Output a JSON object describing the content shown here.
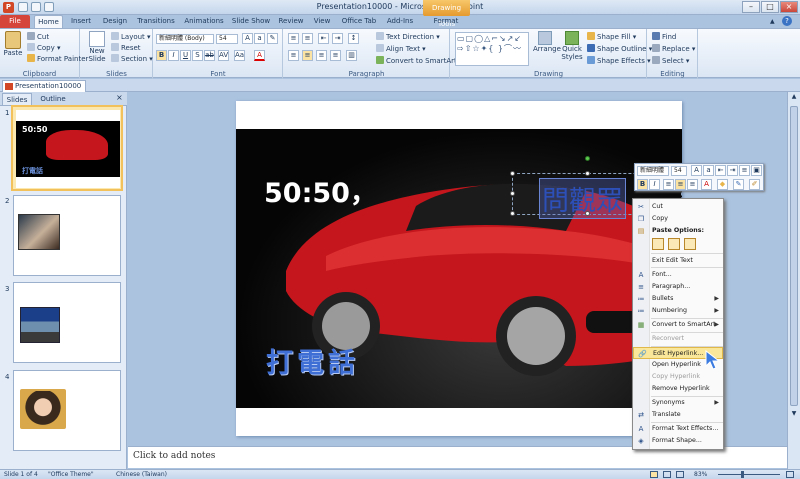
{
  "window": {
    "title": "Presentation10000  -  Microsoft PowerPoint",
    "contextual_tab_group": "Drawing Tools"
  },
  "tabs": [
    "File",
    "Home",
    "Insert",
    "Design",
    "Transitions",
    "Animations",
    "Slide Show",
    "Review",
    "View",
    "Office Tab",
    "Add-Ins",
    "Format"
  ],
  "ribbon": {
    "clipboard": {
      "label": "Clipboard",
      "paste": "Paste",
      "cut": "Cut",
      "copy": "Copy",
      "format_painter": "Format Painter"
    },
    "slides": {
      "label": "Slides",
      "new_slide": "New Slide",
      "layout": "Layout",
      "reset": "Reset",
      "section": "Section"
    },
    "font": {
      "label": "Font",
      "font_name": "新細明體 (Body)",
      "font_size": "54"
    },
    "paragraph": {
      "label": "Paragraph",
      "text_direction": "Text Direction",
      "align_text": "Align Text",
      "convert_smartart": "Convert to SmartArt"
    },
    "drawing": {
      "label": "Drawing",
      "arrange": "Arrange",
      "quick_styles": "Quick Styles",
      "shape_fill": "Shape Fill",
      "shape_outline": "Shape Outline",
      "shape_effects": "Shape Effects"
    },
    "editing": {
      "label": "Editing",
      "find": "Find",
      "replace": "Replace",
      "select": "Select"
    }
  },
  "doc_tab": "Presentation10000",
  "pane_tabs": [
    "Slides",
    "Outline"
  ],
  "thumbnails": [
    {
      "number": "1",
      "title": "50:50",
      "caption": "打電話"
    },
    {
      "number": "2"
    },
    {
      "number": "3"
    },
    {
      "number": "4"
    }
  ],
  "slide": {
    "title_text": "50:50，",
    "selected_text": "問觀眾",
    "bottom_text": "打電話"
  },
  "notes_placeholder": "Click to add notes",
  "mini_toolbar": {
    "font_name": "新細明體",
    "font_size": "54"
  },
  "context_menu": {
    "items": [
      {
        "label": "Cut",
        "icon": "scissors-icon",
        "enabled": true
      },
      {
        "label": "Copy",
        "icon": "copy-icon",
        "enabled": true
      },
      {
        "label": "Paste Options:",
        "icon": "paste-icon",
        "enabled": true
      },
      {
        "label": "Exit Edit Text",
        "icon": "",
        "enabled": true
      },
      {
        "label": "Font...",
        "icon": "font-icon",
        "enabled": true
      },
      {
        "label": "Paragraph...",
        "icon": "paragraph-icon",
        "enabled": true
      },
      {
        "label": "Bullets",
        "icon": "bullets-icon",
        "enabled": true,
        "submenu": true
      },
      {
        "label": "Numbering",
        "icon": "numbering-icon",
        "enabled": true,
        "submenu": true
      },
      {
        "label": "Convert to SmartArt",
        "icon": "smartart-icon",
        "enabled": true,
        "submenu": true
      },
      {
        "label": "Reconvert",
        "icon": "",
        "enabled": false
      },
      {
        "label": "Edit Hyperlink...",
        "icon": "hyperlink-icon",
        "enabled": true,
        "highlighted": true
      },
      {
        "label": "Open Hyperlink",
        "icon": "",
        "enabled": true
      },
      {
        "label": "Copy Hyperlink",
        "icon": "",
        "enabled": false
      },
      {
        "label": "Remove Hyperlink",
        "icon": "",
        "enabled": true
      },
      {
        "label": "Synonyms",
        "icon": "",
        "enabled": true,
        "submenu": true
      },
      {
        "label": "Translate",
        "icon": "translate-icon",
        "enabled": true
      },
      {
        "label": "Format Text Effects...",
        "icon": "text-effects-icon",
        "enabled": true
      },
      {
        "label": "Format Shape...",
        "icon": "format-shape-icon",
        "enabled": true
      }
    ]
  },
  "status": {
    "slide": "Slide 1 of 4",
    "theme": "\"Office Theme\"",
    "language": "Chinese (Taiwan)",
    "zoom": "83%"
  },
  "colors": {
    "accent": "#d6453a",
    "ribbon": "#dbe6f4",
    "car": "#d01818",
    "highlight": "#fbe79a"
  }
}
